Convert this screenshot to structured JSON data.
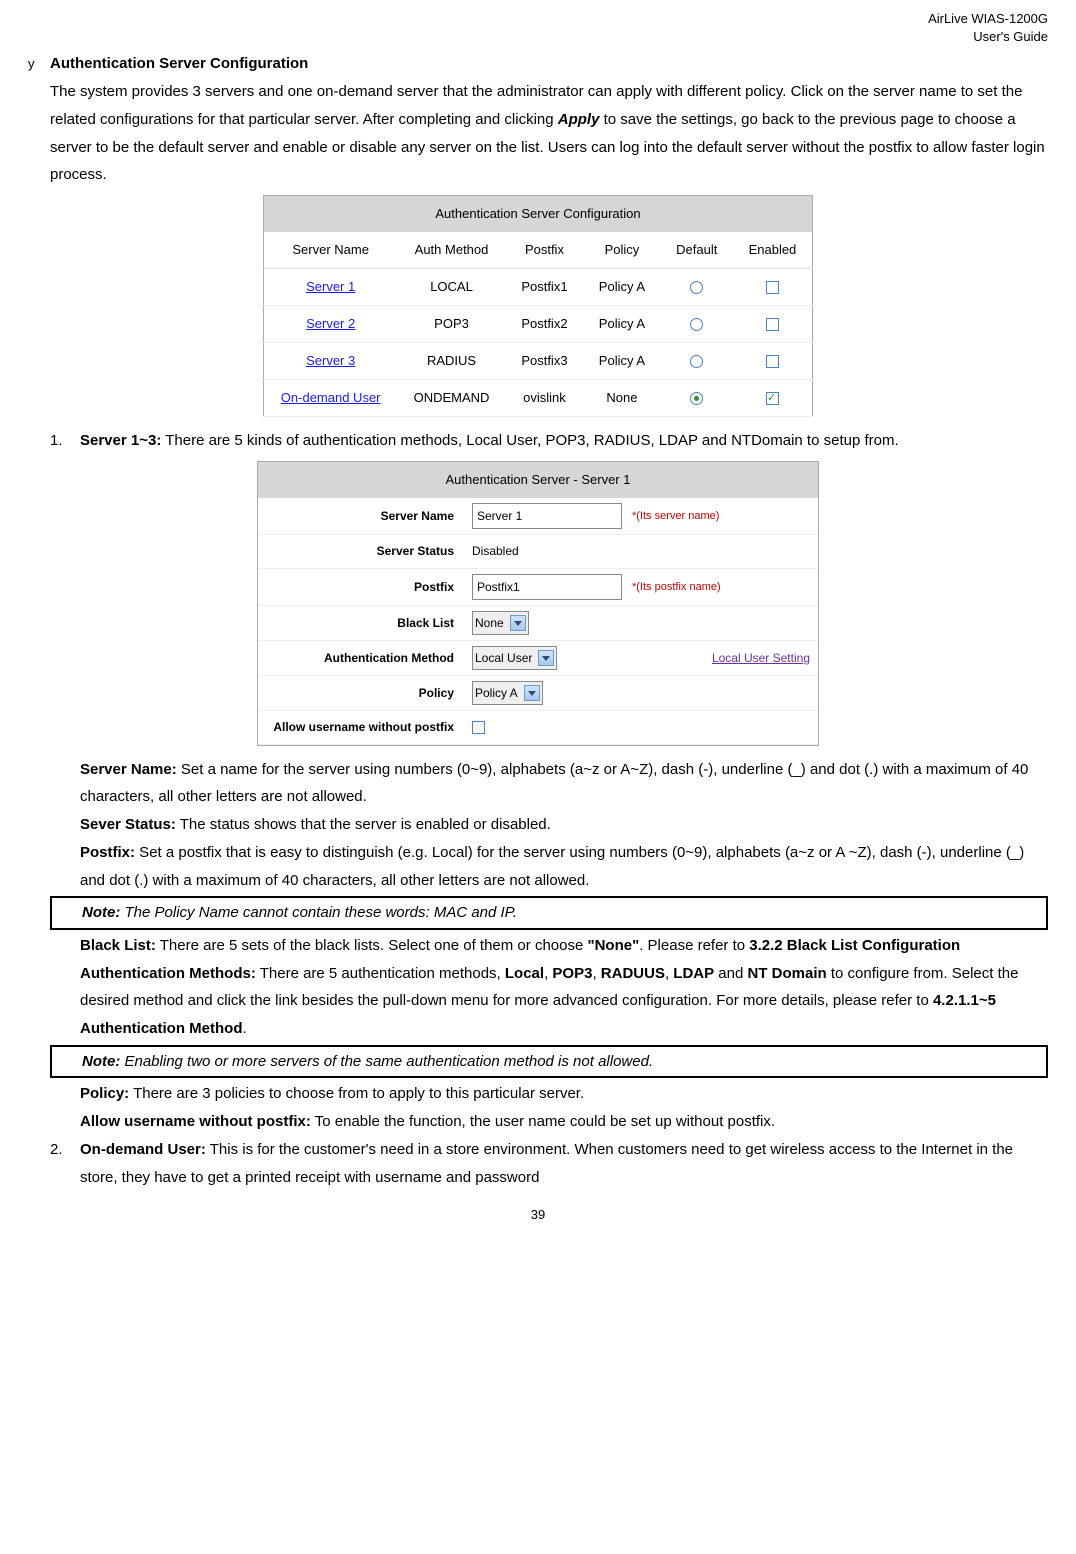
{
  "header": {
    "line1": "AirLive WIAS-1200G",
    "line2": "User's Guide"
  },
  "bullet": {
    "symbol": "y",
    "title": "Authentication Server Configuration"
  },
  "intro": {
    "seg1": "The system provides 3 servers and one on-demand server that the administrator can apply with different policy. Click on the server name to set the related configurations for that particular server. After completing and clicking ",
    "apply": "Apply",
    "seg2": " to save the settings, go back to the previous page to choose a server to be the default server and enable or disable any server on the list. Users can log into the default server without the postfix to allow faster login process."
  },
  "table1": {
    "title": "Authentication Server Configuration",
    "headers": [
      "Server Name",
      "Auth Method",
      "Postfix",
      "Policy",
      "Default",
      "Enabled"
    ],
    "rows": [
      {
        "name": "Server 1",
        "method": "LOCAL",
        "postfix": "Postfix1",
        "policy": "Policy A",
        "default": false,
        "enabled": false
      },
      {
        "name": "Server 2",
        "method": "POP3",
        "postfix": "Postfix2",
        "policy": "Policy A",
        "default": false,
        "enabled": false
      },
      {
        "name": "Server 3",
        "method": "RADIUS",
        "postfix": "Postfix3",
        "policy": "Policy A",
        "default": false,
        "enabled": false
      },
      {
        "name": "On-demand User",
        "method": "ONDEMAND",
        "postfix": "ovislink",
        "policy": "None",
        "default": true,
        "enabled": true
      }
    ]
  },
  "ol1": {
    "num": "1.",
    "lead": "Server 1~3:",
    "text": " There are 5 kinds of authentication methods, Local User, POP3, RADIUS, LDAP and NTDomain to setup from."
  },
  "form": {
    "title": "Authentication Server - Server 1",
    "server_name_label": "Server Name",
    "server_name_value": "Server 1",
    "server_name_hint": "*(Its server name)",
    "server_status_label": "Server Status",
    "server_status_value": "Disabled",
    "postfix_label": "Postfix",
    "postfix_value": "Postfix1",
    "postfix_hint": "*(Its postfix name)",
    "blacklist_label": "Black List",
    "blacklist_value": "None",
    "authmethod_label": "Authentication Method",
    "authmethod_value": "Local User",
    "authmethod_link": "Local User Setting",
    "policy_label": "Policy",
    "policy_value": "Policy A",
    "allow_label": "Allow username without postfix"
  },
  "defs": {
    "server_name_lead": "Server Name:",
    "server_name_text": " Set a name for the server using numbers (0~9), alphabets (a~z or A~Z), dash (-), underline (_) and dot (.) with a maximum of 40 characters, all other letters are not allowed.",
    "sever_status_lead": "Sever Status:",
    "sever_status_text": " The status shows that the server is enabled or disabled.",
    "postfix_lead": "Postfix:",
    "postfix_text": " Set a postfix that is easy to distinguish (e.g. Local) for the server using numbers (0~9), alphabets (a~z or A ~Z), dash (-), underline (_) and dot (.) with a maximum of 40 characters, all other letters are not allowed."
  },
  "note1": {
    "lead": "Note:",
    "text": " The Policy Name cannot contain these words: MAC and IP."
  },
  "defs2": {
    "bl_lead": "Black List:",
    "bl_seg1": " There are 5 sets of the black lists. Select one of them or choose ",
    "bl_none": "\"None\"",
    "bl_seg2": ". Please refer to ",
    "bl_ref": "3.2.2 Black List Configuration",
    "am_lead": "Authentication Methods:",
    "am_seg1": " There are 5 authentication methods, ",
    "am_local": "Local",
    "am_c1": ", ",
    "am_pop3": "POP3",
    "am_c2": ", ",
    "am_raduus": "RADUUS",
    "am_c3": ", ",
    "am_ldap": "LDAP",
    "am_and": " and ",
    "am_nt": "NT Domain",
    "am_seg2": " to configure from. Select the desired method and click the link besides the pull-down menu for more advanced configuration. For more details, please refer to ",
    "am_ref": "4.2.1.1~5 Authentication Method",
    "am_period": "."
  },
  "note2": {
    "lead": "Note:",
    "text": " Enabling two or more servers of the same authentication method is not allowed."
  },
  "defs3": {
    "policy_lead": "Policy:",
    "policy_text": " There are 3 policies to choose from to apply to this particular server.",
    "allow_lead": "Allow username without postfix:",
    "allow_text": " To enable the function, the user name could be set up without postfix."
  },
  "ol2": {
    "num": "2.",
    "lead": "On-demand User:",
    "text": " This is for the customer's need in a store environment. When customers need to get wireless access to the Internet in the store, they have to get a printed receipt with username and password"
  },
  "page_num": "39"
}
